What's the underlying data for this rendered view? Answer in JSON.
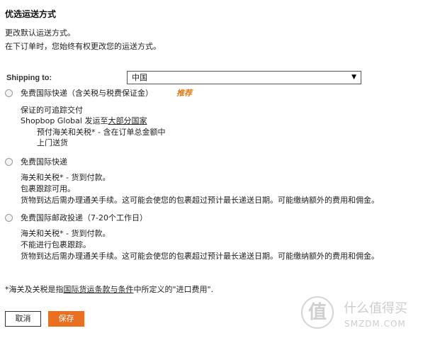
{
  "page": {
    "title": "优选运送方式",
    "subtitle_line1": "更改默认运送方式。",
    "subtitle_line2": "在下订单时，您始终有权更改您的运送方式。"
  },
  "shipping_to": {
    "label": "Shipping to:",
    "selected": "中国",
    "arrow": "▼"
  },
  "options": [
    {
      "label": "免费国际快递（含关税与税费保证金）",
      "badge": "推荐",
      "line1": "保证的可追踪交付",
      "line2_prefix": "Shopbop Global 发运至",
      "line2_link": "大部分国家",
      "line3": "预付海关和关税* - 含在订单总金额中",
      "line4": "上门送货"
    },
    {
      "label": "免费国际快递",
      "line1": "海关和关税* - 货到付款。",
      "line2": "包裹跟踪可用。",
      "line3": "货物到达后需办理通关手续。这可能会使您的包裹超过预计最长递送日期。可能缴纳额外的费用和佣金。"
    },
    {
      "label": "免费国际邮政投递（7-20个工作日）",
      "line1": "海关和关税* - 货到付款。",
      "line2": "不能进行包裹跟踪。",
      "line3": "货物到达后需办理通关手续。这可能会使您的包裹超过预计最长递送日期。可能缴纳额外的费用和佣金。"
    }
  ],
  "footnote": {
    "prefix": "*海关及关税是指",
    "link": "国际货运条款与条件",
    "suffix": "中所定义的\"进口费用\"."
  },
  "buttons": {
    "cancel": "取消",
    "save": "保存"
  },
  "watermark": {
    "logo": "值",
    "text_cn": "什么值得买",
    "text_en": "SMZDM.COM"
  },
  "colors": {
    "accent": "#ea6f21",
    "recommend": "#e07a16"
  }
}
